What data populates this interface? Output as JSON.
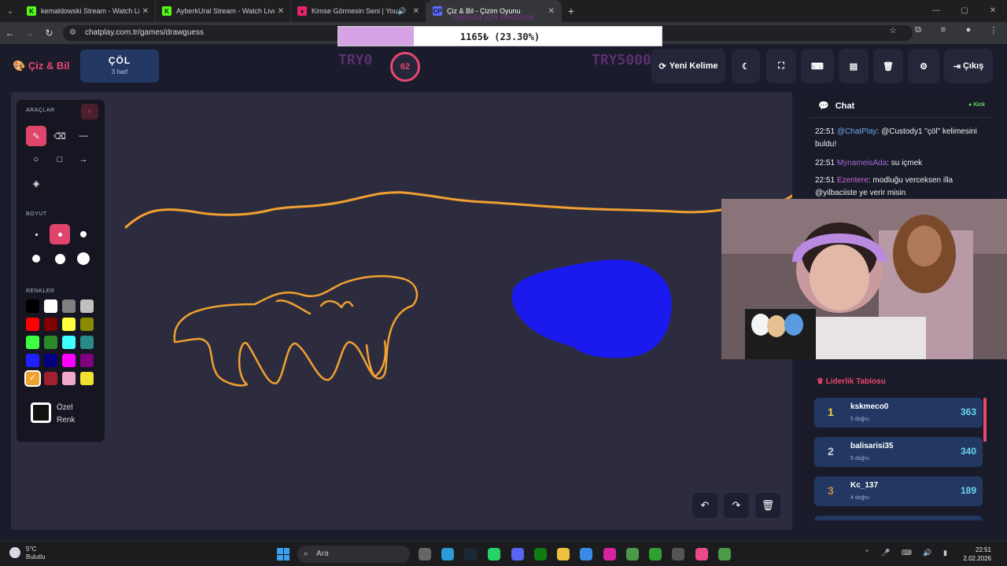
{
  "browser": {
    "tabs": [
      {
        "title": "kemaldowski Stream - Watch Live",
        "favicon": "K",
        "favicon_color": "#53fc18",
        "active": false,
        "audio": false
      },
      {
        "title": "AyberkUral Stream - Watch Live",
        "favicon": "K",
        "favicon_color": "#53fc18",
        "active": false,
        "audio": false
      },
      {
        "title": "Kimse Görmesin Seni | YouTube",
        "favicon": "●",
        "favicon_color": "#e8236b",
        "active": false,
        "audio": true
      },
      {
        "title": "Çiz & Bil - Çizim Oyunu",
        "favicon": "CP",
        "favicon_color": "#5b6cff",
        "active": true,
        "audio": false
      }
    ],
    "url": "chatplay.com.tr/games/drawguess"
  },
  "overlay": {
    "donation_text": "1165₺ (23.30%)",
    "donation_fraction": 0.233,
    "note": "Yayında için destekle"
  },
  "header": {
    "brand": "Çiz & Bil",
    "word": "ÇÖL",
    "word_hint": "3 harf",
    "try_left": "TRY0",
    "try_right": "TRY5000",
    "timer": "62",
    "new_word_label": "Yeni Kelime",
    "exit_label": "Çıkış"
  },
  "toolbox": {
    "tools_label": "ARAÇLAR",
    "size_label": "BOYUT",
    "colors_label": "RENKLER",
    "custom_color_line1": "Özel",
    "custom_color_line2": "Renk",
    "colors": [
      "#000000",
      "#ffffff",
      "#808080",
      "#c0c0c0",
      "#ff0000",
      "#800000",
      "#ffff40",
      "#8a8a00",
      "#40ff40",
      "#2a8a2a",
      "#40ffff",
      "#2a8a8a",
      "#2020ff",
      "#000080",
      "#ff00ff",
      "#800080",
      "#f0a030",
      "#a02030",
      "#f0a8c8",
      "#f0e030"
    ],
    "selected_color": "#f0a030"
  },
  "chat": {
    "title": "Chat",
    "platform": "Kick",
    "messages": [
      {
        "time": "22:51",
        "user": "@ChatPlay",
        "text": ": @Custody1 \"çöl\" kelimesini buldu!"
      },
      {
        "time": "22:51",
        "user": "MynameisAda",
        "text": ": su içmek"
      },
      {
        "time": "22:51",
        "user": "Ezentere",
        "text": ": modluğu verceksen illa @yilbaciiste ye verir misin"
      }
    ]
  },
  "leaderboard": {
    "title": "Liderlik Tablosu",
    "rows": [
      {
        "rank": "1",
        "name": "kskmeco0",
        "sub": "5 doğru",
        "score": "363",
        "rank_color": "#f0d040"
      },
      {
        "rank": "2",
        "name": "balisarisi35",
        "sub": "5 doğru",
        "score": "340",
        "rank_color": "#c8d0e0"
      },
      {
        "rank": "3",
        "name": "Kc_137",
        "sub": "4 doğru",
        "score": "189",
        "rank_color": "#d08840"
      }
    ]
  },
  "taskbar": {
    "temp": "5°C",
    "weather": "Bulutlu",
    "search_placeholder": "Ara",
    "time": "22:51",
    "date": "2.02.2026"
  }
}
